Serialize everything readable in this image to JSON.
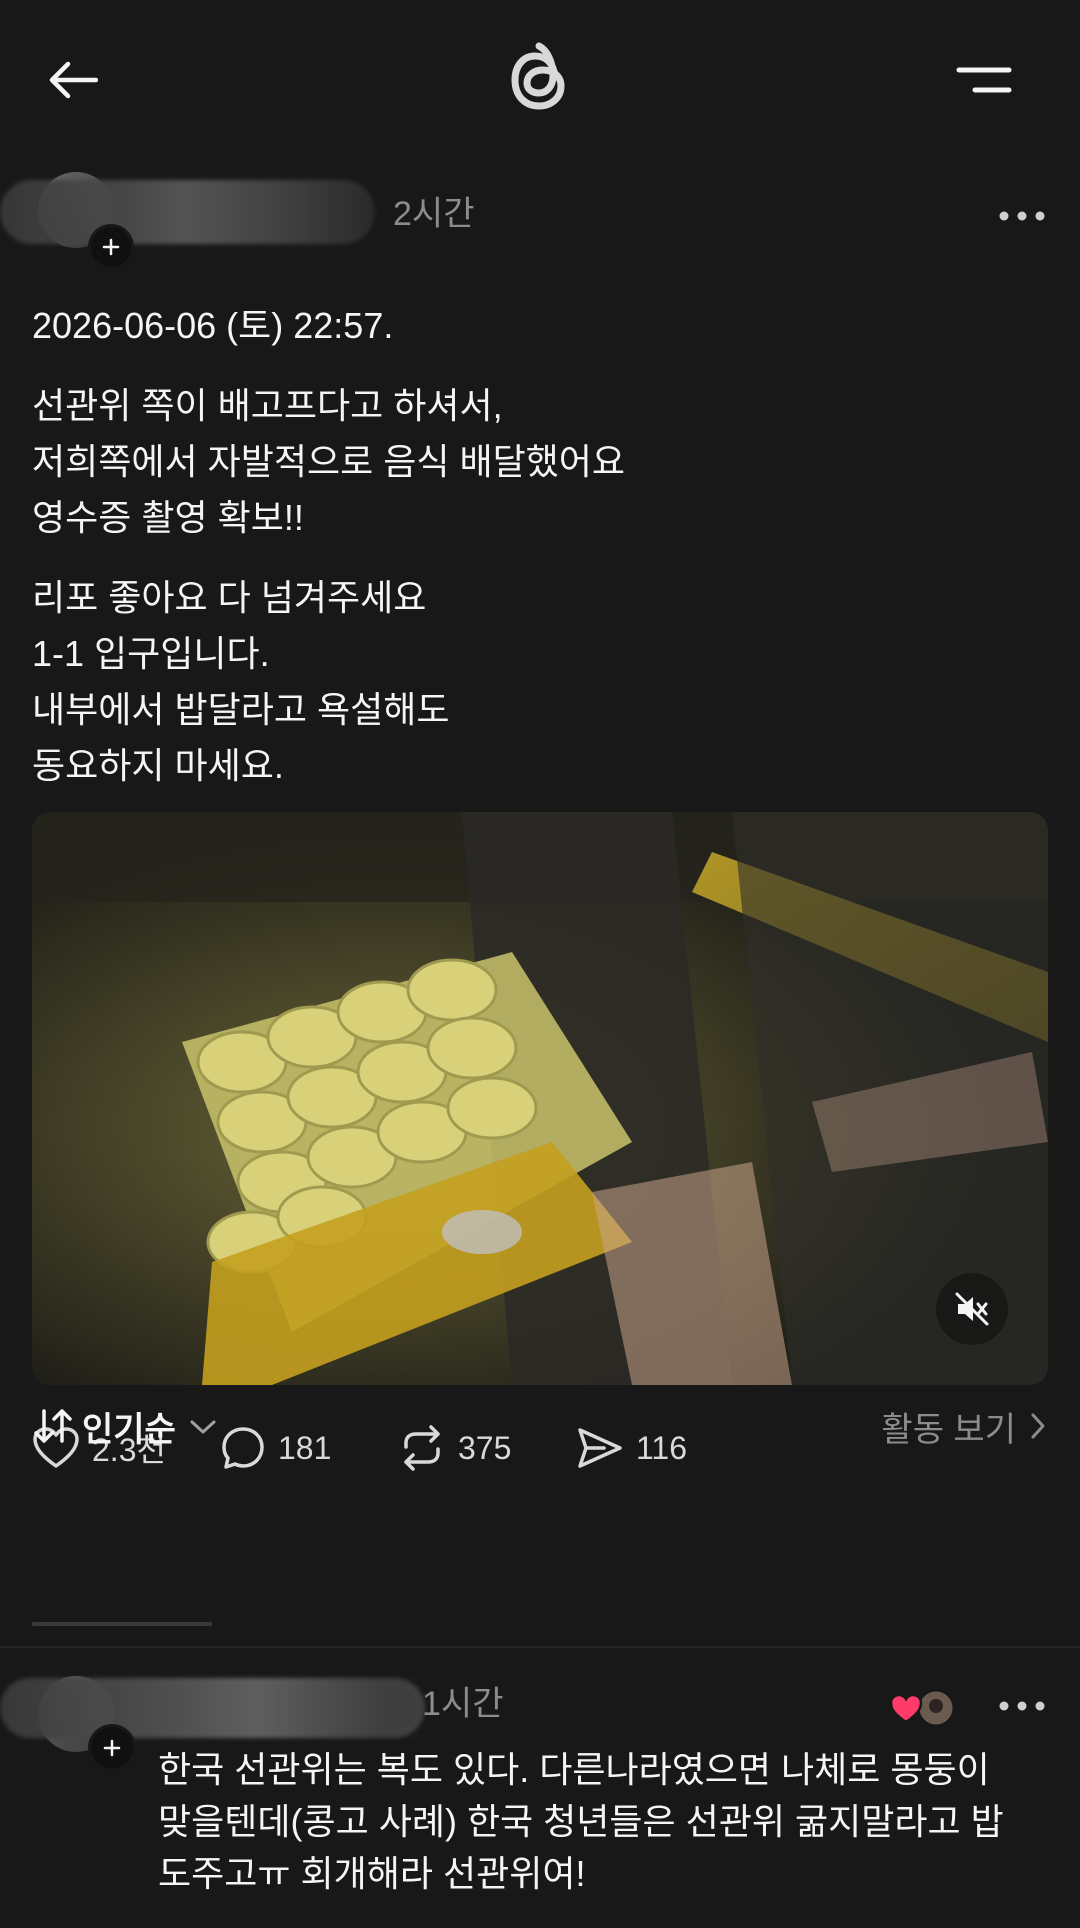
{
  "header": {
    "back_icon": "arrow-left-icon",
    "logo_icon": "threads-logo-icon",
    "menu_icon": "menu-icon"
  },
  "post": {
    "time": "2시간",
    "date_line": "2026-06-06 (토) 22:57.",
    "paragraph1": [
      "선관위 쪽이 배고프다고 하셔서,",
      "저희쪽에서 자발적으로 음식 배달했어요",
      "영수증 촬영 확보!!"
    ],
    "paragraph2": [
      "리포 좋아요 다 넘겨주세요",
      "1-1 입구입니다.",
      "내부에서 밥달라고 욕설해도",
      "동요하지 마세요."
    ],
    "media_icon": "mute-icon",
    "actions": {
      "likes": "2.3천",
      "comments": "181",
      "reposts": "375",
      "shares": "116"
    }
  },
  "sort": {
    "label": "인기순",
    "activity_label": "활동 보기"
  },
  "reply": {
    "time": "1시간",
    "lines": [
      "한국 선관위는 복도 있다. 다른나라였으면 나체로 몽둥이",
      "맞을텐데(콩고 사례) 한국 청년들은 선관위 굶지말라고 밥",
      "도주고ㅠ 회개해라 선관위여!"
    ]
  },
  "colors": {
    "background": "#181818",
    "text_primary": "#f3f5f7",
    "text_secondary": "#8c8c8c",
    "like_heart": "#ff3b6b"
  }
}
